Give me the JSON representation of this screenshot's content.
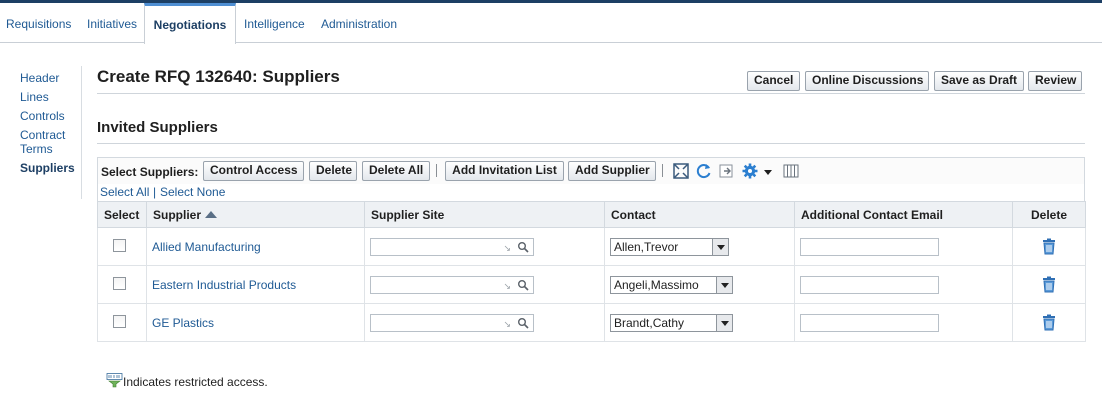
{
  "tabs": [
    {
      "label": "Requisitions"
    },
    {
      "label": "Initiatives"
    },
    {
      "label": "Negotiations"
    },
    {
      "label": "Intelligence"
    },
    {
      "label": "Administration"
    }
  ],
  "sidenav": {
    "items": [
      {
        "label": "Header"
      },
      {
        "label": "Lines"
      },
      {
        "label": "Controls"
      },
      {
        "label": "Contract"
      },
      {
        "label": "Terms"
      },
      {
        "label": "Suppliers"
      }
    ]
  },
  "page": {
    "title": "Create RFQ 132640: Suppliers",
    "buttons": {
      "cancel": "Cancel",
      "online_discussions": "Online Discussions",
      "save_as_draft": "Save as Draft",
      "review": "Review"
    }
  },
  "section": {
    "title": "Invited Suppliers"
  },
  "toolbar": {
    "label": "Select Suppliers:",
    "control_access": "Control Access",
    "delete": "Delete",
    "delete_all": "Delete All",
    "add_invitation_list": "Add Invitation List",
    "add_supplier": "Add Supplier",
    "icons": [
      "detach-icon",
      "refresh-icon",
      "export-icon",
      "gear-icon",
      "chevron-down-icon",
      "columns-icon"
    ]
  },
  "selection": {
    "select_all": "Select All",
    "separator": "|",
    "select_none": "Select None"
  },
  "table": {
    "headers": {
      "select": "Select",
      "supplier": "Supplier",
      "site": "Supplier Site",
      "contact": "Contact",
      "email": "Additional Contact Email",
      "delete": "Delete"
    },
    "rows": [
      {
        "supplier": "Allied Manufacturing",
        "contact": "Allen,Trevor",
        "site": "",
        "email": ""
      },
      {
        "supplier": "Eastern Industrial Products",
        "contact": "Angeli,Massimo",
        "site": "",
        "email": ""
      },
      {
        "supplier": "GE Plastics",
        "contact": "Brandt,Cathy",
        "site": "",
        "email": ""
      }
    ]
  },
  "footnote": {
    "text": "Indicates restricted access."
  },
  "colors": {
    "link": "#1f5a94",
    "tab_accent": "#4f8fd3",
    "top_bar": "#1d3f64",
    "trash_icon": "#2f6fb4"
  }
}
